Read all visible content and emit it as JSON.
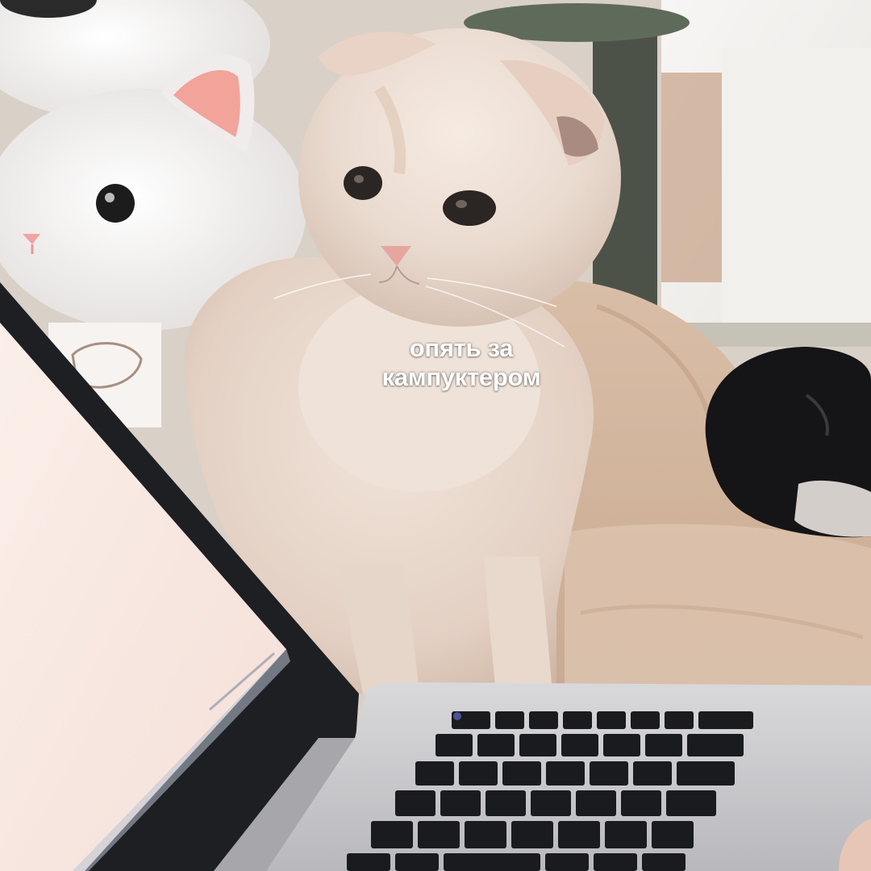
{
  "caption": {
    "line1": "опять за",
    "line2": "кампуктером"
  },
  "colors": {
    "wall": "#d8cfc7",
    "window_light": "#f3f1ee",
    "curtain": "#c9a68d",
    "bedding": "#d6b9a0",
    "plush": "#f4f1ef",
    "plush_ear_inner": "#f2a39a",
    "cat_fur": "#ecdcd0",
    "cat_fur_shadow": "#d8c1b1",
    "black_cat": "#151416",
    "laptop_body": "#c9c9cc",
    "laptop_bezel": "#1d1f23",
    "screen": "#f7e7e1",
    "keys": "#1a1b1e"
  },
  "icons": [
    "plush-toy-icon",
    "scottish-fold-cat-icon",
    "black-cat-icon",
    "laptop-icon",
    "keyboard-icon"
  ]
}
